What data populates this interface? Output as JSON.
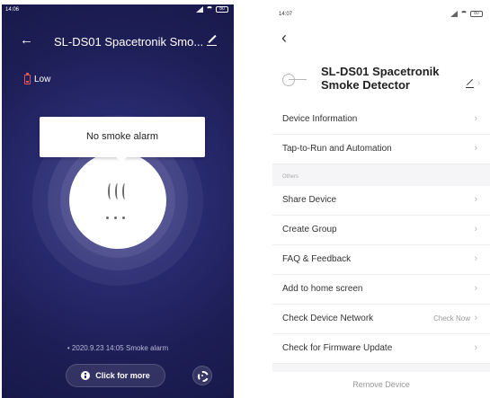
{
  "left_phone": {
    "status_bar": {
      "time": "14:06",
      "battery": "80"
    },
    "header": {
      "back_icon": "arrow-left-icon",
      "title": "SL-DS01 Spacetronik Smo...",
      "edit_icon": "pencil-icon"
    },
    "battery_status": {
      "icon": "battery-low-icon",
      "label": "Low"
    },
    "alarm_status": {
      "text": "No smoke alarm"
    },
    "center_icon": "smoke-icon",
    "log_line": "2020.9.23 14:05 Smoke alarm",
    "more_button": {
      "icon": "info-icon",
      "label": "Click for more"
    },
    "settings_icon": "gear-icon",
    "colors": {
      "background": "#1d1e55",
      "accent": "#2a2c74"
    }
  },
  "right_phone": {
    "status_bar": {
      "time": "14:07",
      "battery": "80"
    },
    "back_icon": "chevron-left-icon",
    "device": {
      "icon": "smoke-detector-icon",
      "name": "SL-DS01 Spacetronik Smoke Detector",
      "edit_icon": "pencil-icon"
    },
    "menu_items": [
      {
        "label": "Device Information"
      },
      {
        "label": "Tap-to-Run and Automation"
      }
    ],
    "section_label": "Others",
    "others_items": [
      {
        "label": "Share Device"
      },
      {
        "label": "Create Group"
      },
      {
        "label": "FAQ & Feedback"
      },
      {
        "label": "Add to home screen"
      },
      {
        "label": "Check Device Network",
        "value": "Check Now"
      },
      {
        "label": "Check for Firmware Update"
      }
    ],
    "remove_button": "Remove Device"
  }
}
